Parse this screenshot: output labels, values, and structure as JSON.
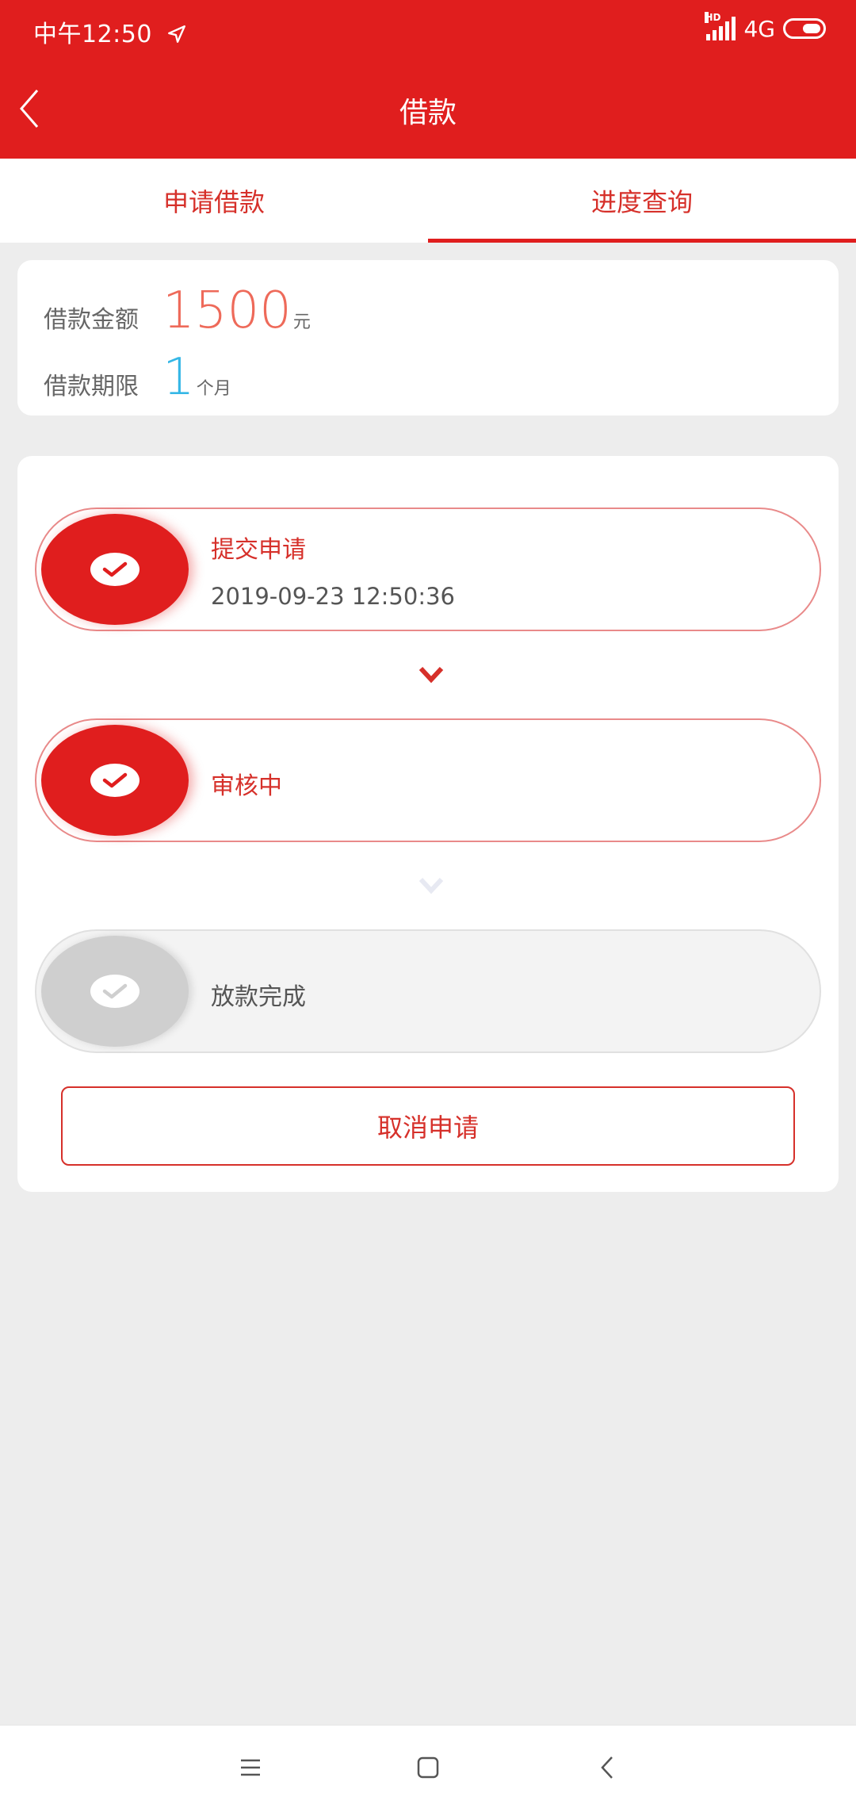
{
  "status_bar": {
    "time": "中午12:50",
    "network": "4G",
    "hd_label": "HD",
    "icons": [
      "location-arrow-icon",
      "signal-icon",
      "battery-icon"
    ]
  },
  "header": {
    "title": "借款",
    "back_icon": "chevron-left-icon"
  },
  "tabs": [
    {
      "label": "申请借款",
      "active": false
    },
    {
      "label": "进度查询",
      "active": true
    }
  ],
  "loan": {
    "amount_label": "借款金额",
    "amount": "1500",
    "amount_unit": "元",
    "term_label": "借款期限",
    "term": "1",
    "term_unit": "个月"
  },
  "progress": {
    "steps": [
      {
        "title": "提交申请",
        "time": "2019-09-23 12:50:36",
        "done": true
      },
      {
        "title": "审核中",
        "done": true
      },
      {
        "title": "放款完成",
        "done": false
      }
    ],
    "cancel_label": "取消申请"
  },
  "colors": {
    "brand_red": "#e01e1e",
    "amount_orange": "#ee6a5a",
    "term_blue": "#35b7e6",
    "pending_gray": "#cfcfcf"
  },
  "nav_bar": {
    "icons": [
      "menu-icon",
      "home-icon",
      "back-icon"
    ]
  }
}
